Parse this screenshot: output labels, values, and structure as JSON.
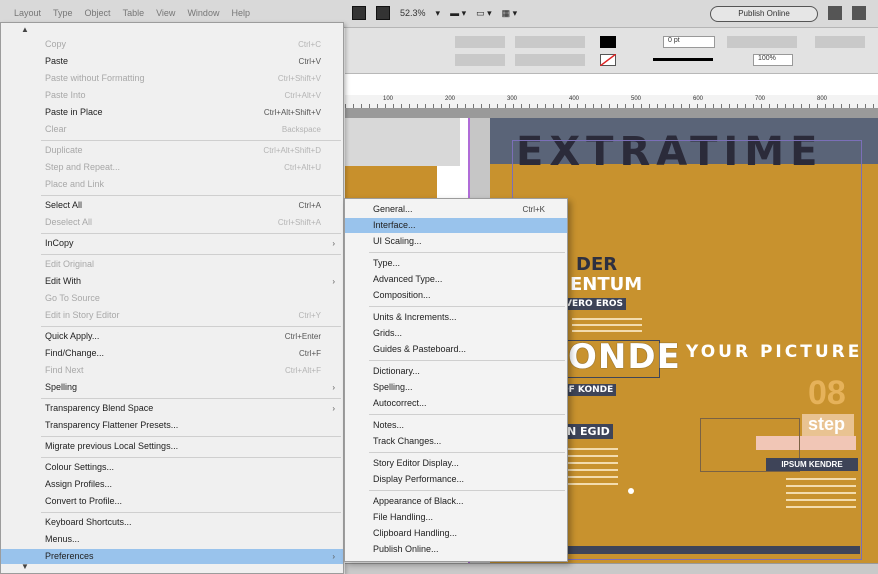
{
  "menubar": {
    "menus": [
      "Layout",
      "Type",
      "Object",
      "Table",
      "View",
      "Window",
      "Help"
    ],
    "zoom": "52.3%",
    "publish_online": "Publish Online"
  },
  "control_panel": {
    "stroke_weight": "0 pt",
    "scale_percent": "100%"
  },
  "ruler": {
    "labels": [
      "100",
      "200",
      "300",
      "400",
      "500",
      "600",
      "700",
      "800"
    ]
  },
  "edit_menu": {
    "items": [
      {
        "label": "Copy",
        "shortcut": "Ctrl+C",
        "disabled": true
      },
      {
        "label": "Paste",
        "shortcut": "Ctrl+V",
        "disabled": false
      },
      {
        "label": "Paste without Formatting",
        "shortcut": "Ctrl+Shift+V",
        "disabled": true
      },
      {
        "label": "Paste Into",
        "shortcut": "Ctrl+Alt+V",
        "disabled": true
      },
      {
        "label": "Paste in Place",
        "shortcut": "Ctrl+Alt+Shift+V",
        "disabled": false
      },
      {
        "label": "Clear",
        "shortcut": "Backspace",
        "disabled": true
      },
      {
        "label": "Duplicate",
        "shortcut": "Ctrl+Alt+Shift+D",
        "disabled": true
      },
      {
        "label": "Step and Repeat...",
        "shortcut": "Ctrl+Alt+U",
        "disabled": true
      },
      {
        "label": "Place and Link",
        "shortcut": "",
        "disabled": true
      },
      {
        "label": "Select All",
        "shortcut": "Ctrl+A",
        "disabled": false
      },
      {
        "label": "Deselect All",
        "shortcut": "Ctrl+Shift+A",
        "disabled": true
      },
      {
        "label": "InCopy",
        "shortcut": "",
        "disabled": false,
        "submenu": true
      },
      {
        "label": "Edit Original",
        "shortcut": "",
        "disabled": true
      },
      {
        "label": "Edit With",
        "shortcut": "",
        "disabled": false,
        "submenu": true
      },
      {
        "label": "Go To Source",
        "shortcut": "",
        "disabled": true
      },
      {
        "label": "Edit in Story Editor",
        "shortcut": "Ctrl+Y",
        "disabled": true
      },
      {
        "label": "Quick Apply...",
        "shortcut": "Ctrl+Enter",
        "disabled": false
      },
      {
        "label": "Find/Change...",
        "shortcut": "Ctrl+F",
        "disabled": false
      },
      {
        "label": "Find Next",
        "shortcut": "Ctrl+Alt+F",
        "disabled": true
      },
      {
        "label": "Spelling",
        "shortcut": "",
        "disabled": false,
        "submenu": true
      },
      {
        "label": "Transparency Blend Space",
        "shortcut": "",
        "disabled": false,
        "submenu": true
      },
      {
        "label": "Transparency Flattener Presets...",
        "shortcut": "",
        "disabled": false
      },
      {
        "label": "Migrate previous Local Settings...",
        "shortcut": "",
        "disabled": false
      },
      {
        "label": "Colour Settings...",
        "shortcut": "",
        "disabled": false
      },
      {
        "label": "Assign Profiles...",
        "shortcut": "",
        "disabled": false
      },
      {
        "label": "Convert to Profile...",
        "shortcut": "",
        "disabled": false
      },
      {
        "label": "Keyboard Shortcuts...",
        "shortcut": "",
        "disabled": false
      },
      {
        "label": "Menus...",
        "shortcut": "",
        "disabled": false
      },
      {
        "label": "Preferences",
        "shortcut": "",
        "disabled": false,
        "submenu": true,
        "selected": true
      }
    ]
  },
  "preferences_submenu": {
    "items": [
      {
        "label": "General...",
        "shortcut": "Ctrl+K"
      },
      {
        "label": "Interface...",
        "shortcut": "",
        "selected": true
      },
      {
        "label": "UI Scaling...",
        "shortcut": ""
      },
      {
        "label": "Type...",
        "shortcut": ""
      },
      {
        "label": "Advanced Type...",
        "shortcut": ""
      },
      {
        "label": "Composition...",
        "shortcut": ""
      },
      {
        "label": "Units & Increments...",
        "shortcut": ""
      },
      {
        "label": "Grids...",
        "shortcut": ""
      },
      {
        "label": "Guides & Pasteboard...",
        "shortcut": ""
      },
      {
        "label": "Dictionary...",
        "shortcut": ""
      },
      {
        "label": "Spelling...",
        "shortcut": ""
      },
      {
        "label": "Autocorrect...",
        "shortcut": ""
      },
      {
        "label": "Notes...",
        "shortcut": ""
      },
      {
        "label": "Track Changes...",
        "shortcut": ""
      },
      {
        "label": "Story Editor Display...",
        "shortcut": ""
      },
      {
        "label": "Display Performance...",
        "shortcut": ""
      },
      {
        "label": "Appearance of Black...",
        "shortcut": ""
      },
      {
        "label": "File Handling...",
        "shortcut": ""
      },
      {
        "label": "Clipboard Handling...",
        "shortcut": ""
      },
      {
        "label": "Publish Online...",
        "shortcut": ""
      }
    ]
  },
  "cover": {
    "masthead": "EXTRATIME",
    "headline_1": "DER",
    "headline_2": "ENTUM",
    "tag_eros": "VERO EROS",
    "headline_onde": "ONDE",
    "tag_konde": "OF KONDE",
    "tag_egid": "N EGID",
    "your_picture": "YOUR PICTURE",
    "number": "08",
    "step": "step",
    "lorem_tag": "IPSUM KENDRE"
  },
  "colors": {
    "menu_bg": "#f0f0f0",
    "selection": "#99c3ec",
    "cover_ochre": "#c8922e",
    "cover_navy": "#3e4458"
  }
}
